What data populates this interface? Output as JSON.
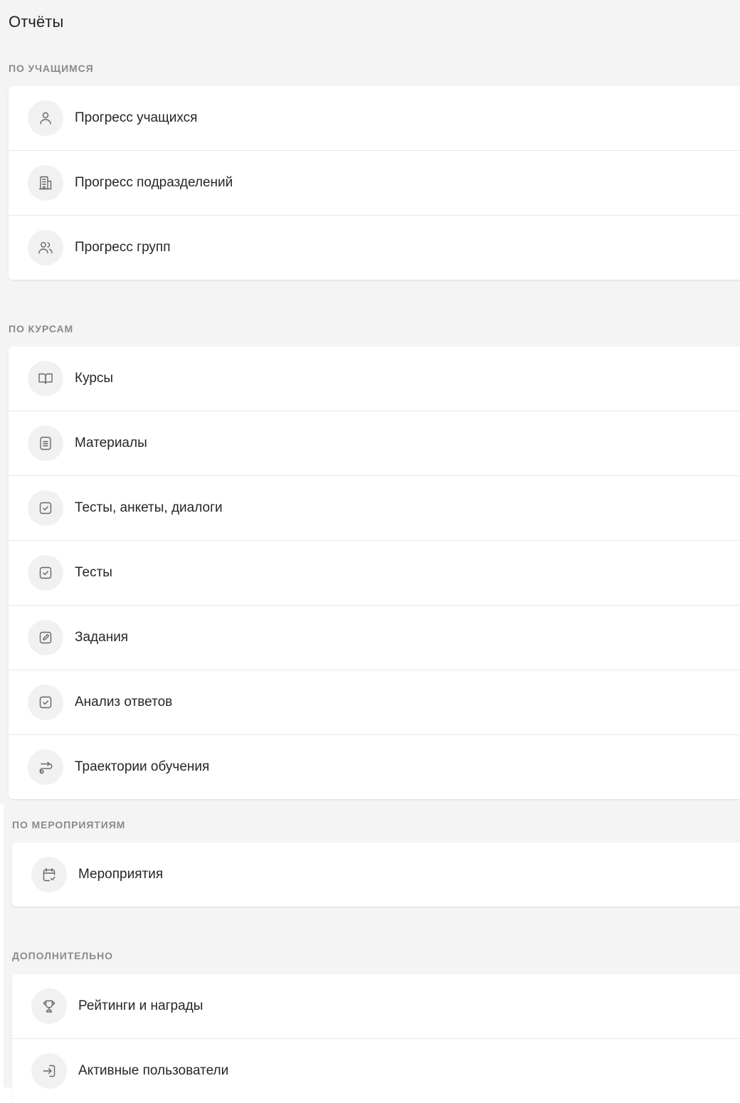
{
  "page": {
    "title": "Отчёты"
  },
  "sections": [
    {
      "label": "По учащимся",
      "items": [
        {
          "label": "Прогресс учащихся",
          "icon": "user-icon"
        },
        {
          "label": "Прогресс подразделений",
          "icon": "building-icon"
        },
        {
          "label": "Прогресс групп",
          "icon": "users-icon"
        }
      ]
    },
    {
      "label": "По курсам",
      "items": [
        {
          "label": "Курсы",
          "icon": "book-open-icon"
        },
        {
          "label": "Материалы",
          "icon": "document-icon"
        },
        {
          "label": "Тесты, анкеты, диалоги",
          "icon": "checkbox-icon"
        },
        {
          "label": "Тесты",
          "icon": "checkbox-icon"
        },
        {
          "label": "Задания",
          "icon": "edit-icon"
        },
        {
          "label": "Анализ ответов",
          "icon": "checkbox-icon"
        },
        {
          "label": "Траектории обучения",
          "icon": "route-icon"
        }
      ]
    },
    {
      "label": "По мероприятиям",
      "items": [
        {
          "label": "Мероприятия",
          "icon": "calendar-check-icon"
        }
      ]
    },
    {
      "label": "Дополнительно",
      "items": [
        {
          "label": "Рейтинги и награды",
          "icon": "trophy-icon"
        },
        {
          "label": "Активные пользователи",
          "icon": "login-icon"
        }
      ]
    }
  ],
  "colors": {
    "page_background": "#f4f4f4",
    "card_background": "#ffffff",
    "icon_circle": "#f1f1f1",
    "icon_stroke": "#666666",
    "section_label": "#8a8a8a",
    "divider": "#e8e8e8"
  }
}
